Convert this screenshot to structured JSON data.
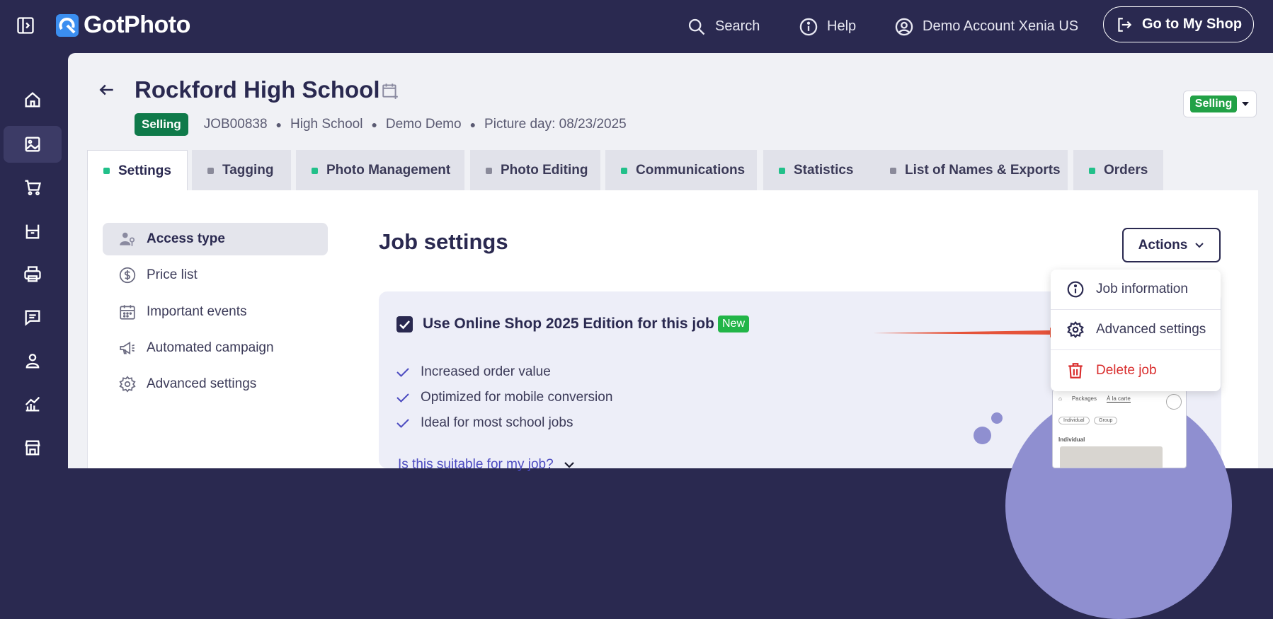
{
  "header": {
    "logo_text": "GotPhoto",
    "search_label": "Search",
    "help_label": "Help",
    "account_label": "Demo Account Xenia US",
    "shop_button_label": "Go to My Shop"
  },
  "sidebar": {
    "items": [
      {
        "icon": "home-icon"
      },
      {
        "icon": "image-icon",
        "active": true
      },
      {
        "icon": "cart-icon"
      },
      {
        "icon": "box-icon"
      },
      {
        "icon": "printer-icon"
      },
      {
        "icon": "chat-icon"
      },
      {
        "icon": "user-icon"
      },
      {
        "icon": "chart-icon"
      },
      {
        "icon": "store-icon"
      }
    ]
  },
  "job": {
    "title": "Rockford High School",
    "status_badge": "Selling",
    "job_id": "JOB00838",
    "school_type": "High School",
    "owner": "Demo Demo",
    "picture_day": "Picture day: 08/23/2025",
    "status_dropdown": "Selling"
  },
  "tabs": [
    {
      "label": "Settings",
      "color": "#22c08a",
      "active": true
    },
    {
      "label": "Tagging",
      "color": "#8a8a9a"
    },
    {
      "label": "Photo Management",
      "color": "#22c08a"
    },
    {
      "label": "Photo Editing",
      "color": "#8a8a9a"
    },
    {
      "label": "Communications",
      "color": "#22c08a"
    },
    {
      "label": "Statistics",
      "color": "#22c08a"
    },
    {
      "label": "List of Names & Exports",
      "color": "#8a8a9a"
    },
    {
      "label": "Orders",
      "color": "#22c08a"
    }
  ],
  "settings_nav": [
    {
      "label": "Access type",
      "icon": "user-key-icon",
      "active": true
    },
    {
      "label": "Price list",
      "icon": "dollar-icon"
    },
    {
      "label": "Important events",
      "icon": "calendar-icon"
    },
    {
      "label": "Automated campaign",
      "icon": "megaphone-icon"
    },
    {
      "label": "Advanced settings",
      "icon": "gear-icon"
    }
  ],
  "content": {
    "heading": "Job settings",
    "actions_label": "Actions",
    "card_title": "Use Online Shop 2025 Edition for this job",
    "new_badge": "New",
    "features": [
      "Increased order value",
      "Optimized for mobile conversion",
      "Ideal for most school jobs"
    ],
    "suitable_link": "Is this suitable for my job?",
    "preview": {
      "tab1": "Packages",
      "tab2": "À la carte",
      "chip1": "Individual",
      "chip2": "Group",
      "section": "Individual"
    }
  },
  "actions_menu": {
    "items": [
      {
        "label": "Job information",
        "icon": "info-icon"
      },
      {
        "label": "Advanced settings",
        "icon": "gear-icon"
      },
      {
        "label": "Delete job",
        "icon": "trash-icon",
        "danger": true
      }
    ]
  },
  "colors": {
    "navy": "#2a2950",
    "accent_arrow": "#e5533a",
    "green": "#22b548"
  }
}
